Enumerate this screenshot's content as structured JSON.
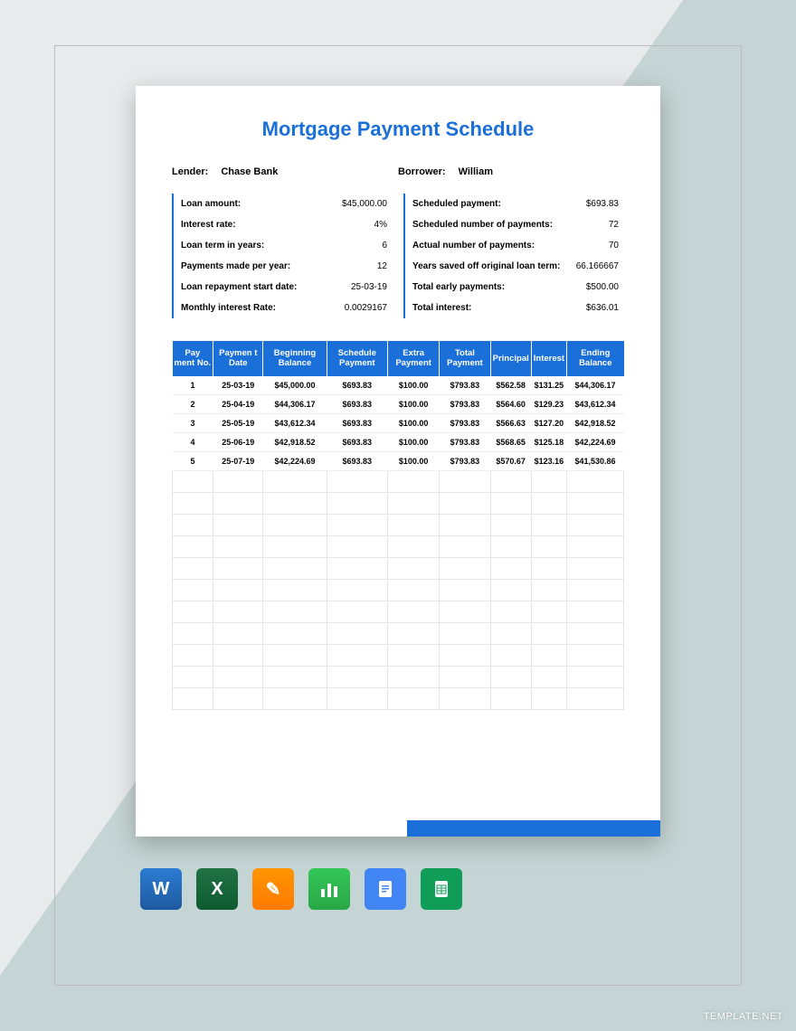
{
  "title": "Mortgage Payment Schedule",
  "lender_label": "Lender:",
  "lender_value": "Chase Bank",
  "borrower_label": "Borrower:",
  "borrower_value": "William",
  "left_info": [
    {
      "label": "Loan amount:",
      "value": "$45,000.00"
    },
    {
      "label": "Interest rate:",
      "value": "4%"
    },
    {
      "label": "Loan term in years:",
      "value": "6"
    },
    {
      "label": "Payments made per year:",
      "value": "12"
    },
    {
      "label": "Loan repayment start date:",
      "value": "25-03-19"
    },
    {
      "label": "Monthly interest Rate:",
      "value": "0.0029167"
    }
  ],
  "right_info": [
    {
      "label": "Scheduled payment:",
      "value": "$693.83"
    },
    {
      "label": "Scheduled number of payments:",
      "value": "72"
    },
    {
      "label": "Actual number of payments:",
      "value": "70"
    },
    {
      "label": "Years saved off original loan term:",
      "value": "66.166667"
    },
    {
      "label": "Total early payments:",
      "value": "$500.00"
    },
    {
      "label": "Total interest:",
      "value": "$636.01"
    }
  ],
  "headers": [
    "Pay ment No.",
    "Paymen t Date",
    "Beginning Balance",
    "Schedule Payment",
    "Extra Payment",
    "Total Payment",
    "Principal",
    "Interest",
    "Ending Balance"
  ],
  "rows": [
    [
      "1",
      "25-03-19",
      "$45,000.00",
      "$693.83",
      "$100.00",
      "$793.83",
      "$562.58",
      "$131.25",
      "$44,306.17"
    ],
    [
      "2",
      "25-04-19",
      "$44,306.17",
      "$693.83",
      "$100.00",
      "$793.83",
      "$564.60",
      "$129.23",
      "$43,612.34"
    ],
    [
      "3",
      "25-05-19",
      "$43,612.34",
      "$693.83",
      "$100.00",
      "$793.83",
      "$566.63",
      "$127.20",
      "$42,918.52"
    ],
    [
      "4",
      "25-06-19",
      "$42,918.52",
      "$693.83",
      "$100.00",
      "$793.83",
      "$568.65",
      "$125.18",
      "$42,224.69"
    ],
    [
      "5",
      "25-07-19",
      "$42,224.69",
      "$693.83",
      "$100.00",
      "$793.83",
      "$570.67",
      "$123.16",
      "$41,530.86"
    ]
  ],
  "empty_rows": 11,
  "watermark": "TEMPLATE.NET",
  "icons": {
    "word": "W",
    "excel": "X",
    "pages": "✎",
    "numbers": "▮",
    "gdocs": "≡",
    "gsheets": "▦"
  }
}
